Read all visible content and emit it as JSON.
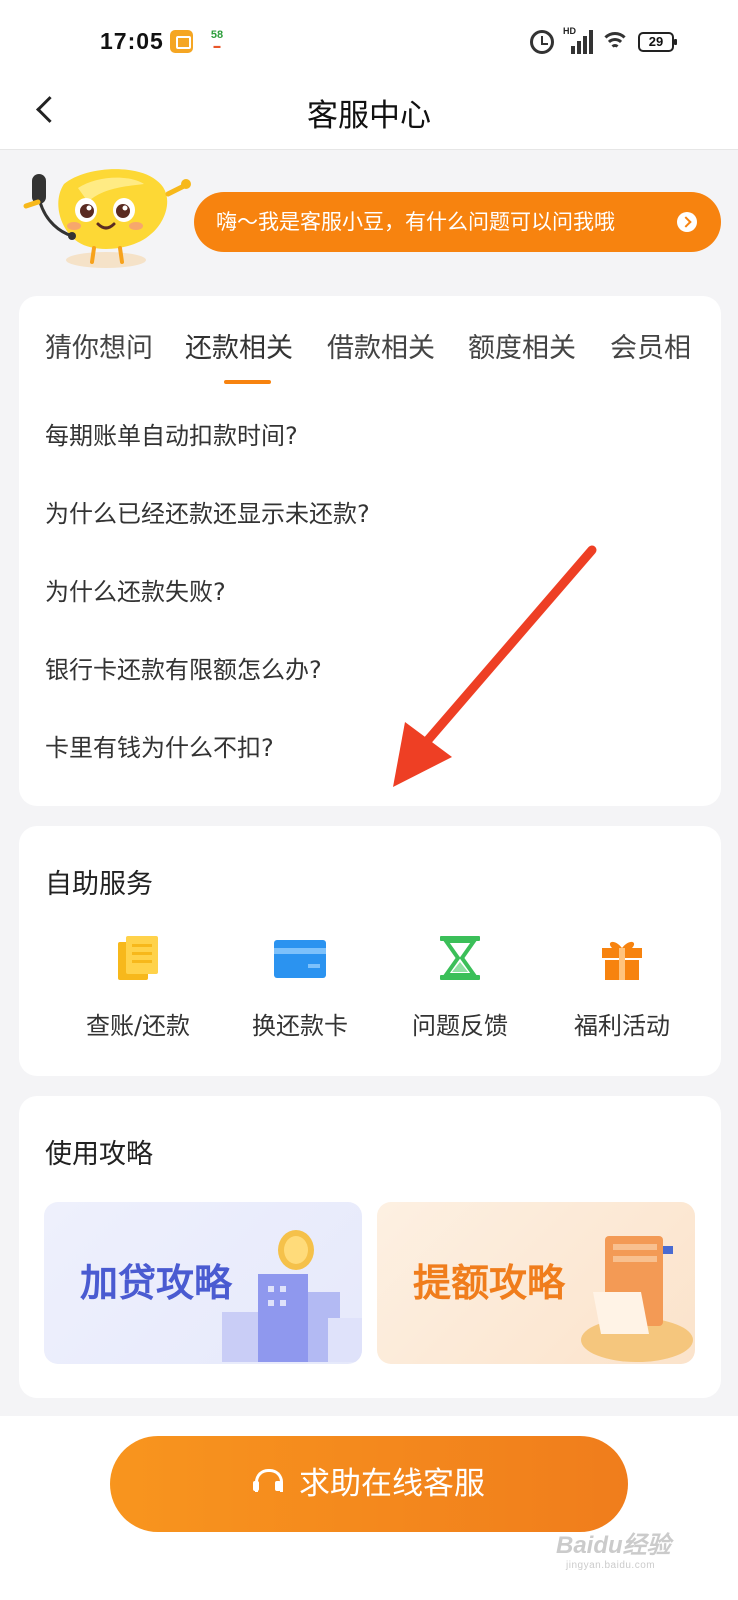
{
  "status_bar": {
    "time": "17:05",
    "notif_badge": "58",
    "signal_label": "HD",
    "battery": "29"
  },
  "nav": {
    "title": "客服中心"
  },
  "greeting": {
    "text": "嗨～我是客服小豆，有什么问题可以问我哦"
  },
  "faq": {
    "tabs": [
      {
        "label": "猜你想问"
      },
      {
        "label": "还款相关"
      },
      {
        "label": "借款相关"
      },
      {
        "label": "额度相关"
      },
      {
        "label": "会员相"
      }
    ],
    "active_tab": "还款相关",
    "items": [
      {
        "text": "每期账单自动扣款时间?"
      },
      {
        "text": "为什么已经还款还显示未还款?"
      },
      {
        "text": "为什么还款失败?"
      },
      {
        "text": "银行卡还款有限额怎么办?"
      },
      {
        "text": "卡里有钱为什么不扣?"
      }
    ]
  },
  "self_service": {
    "title": "自助服务",
    "items": [
      {
        "label": "查账/还款",
        "icon": "ledger-icon",
        "color": "#f7b81b"
      },
      {
        "label": "换还款卡",
        "icon": "bank-card-icon",
        "color": "#2b93f0"
      },
      {
        "label": "问题反馈",
        "icon": "hourglass-icon",
        "color": "#3bbf59"
      },
      {
        "label": "福利活动",
        "icon": "gift-icon",
        "color": "#f7830f"
      }
    ]
  },
  "guides": {
    "title": "使用攻略",
    "items": [
      {
        "label": "加贷攻略"
      },
      {
        "label": "提额攻略"
      }
    ]
  },
  "help_button": {
    "label": "求助在线客服"
  },
  "watermark": {
    "brand": "Baidu经验",
    "url": "jingyan.baidu.com"
  },
  "colors": {
    "accent": "#f7830f",
    "annotation_arrow": "#ee3f24"
  }
}
